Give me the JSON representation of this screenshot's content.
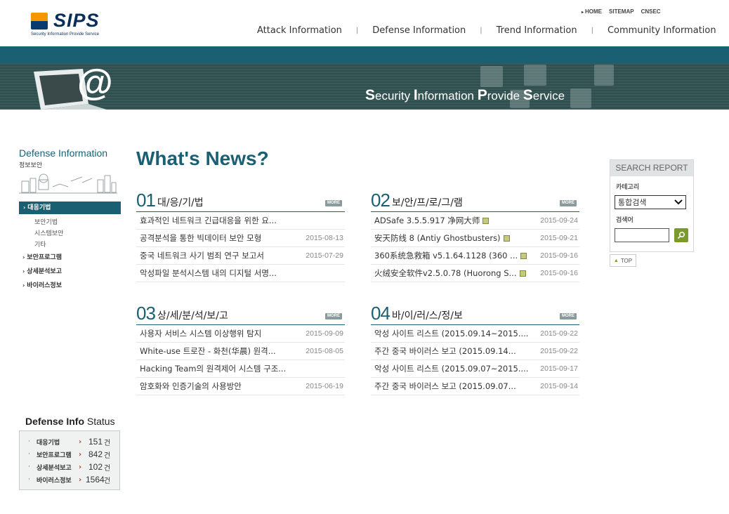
{
  "header": {
    "logo_text": "SIPS",
    "logo_sub": "Security Information Provide Service",
    "util_nav": [
      "HOME",
      "SITEMAP",
      "CNSEC"
    ],
    "gnb": [
      "Attack Information",
      "Defense Information",
      "Trend Information",
      "Community Information"
    ]
  },
  "banner": {
    "tagline": [
      "S",
      "ecurity ",
      "I",
      "nformation ",
      "P",
      "rovide ",
      "S",
      "ervice"
    ]
  },
  "sidebar": {
    "title": "Defense Information",
    "subtitle": "정보보안",
    "active": "대응기법",
    "sub_items": [
      "보안기법",
      "시스템보안",
      "기타"
    ],
    "items": [
      "보안프로그램",
      "상세분석보고",
      "바이러스정보"
    ]
  },
  "status": {
    "title_bold": "Defense Info",
    "title_rest": "Status",
    "rows": [
      {
        "label": "대응기법",
        "count": "151",
        "unit": "건"
      },
      {
        "label": "보안프로그램",
        "count": "842",
        "unit": "건"
      },
      {
        "label": "상세분석보고",
        "count": "102",
        "unit": "건"
      },
      {
        "label": "바이러스정보",
        "count": "1564",
        "unit": "건"
      }
    ]
  },
  "main": {
    "title": "What's News?",
    "more_label": "MORE",
    "boards": [
      {
        "num": "01",
        "name": "대/응/기/법",
        "items": [
          {
            "title": "효과적인 네트워크 긴급대응을 위한 요...",
            "date": "",
            "file": false
          },
          {
            "title": "공격분석을 통한 빅데이터 보안 모형",
            "date": "2015-08-13",
            "file": false
          },
          {
            "title": "중국 네트워크 사기 범죄 연구 보고서",
            "date": "2015-07-29",
            "file": false
          },
          {
            "title": "악성파일 분석시스템 내의 디지털 서명...",
            "date": "",
            "file": false
          }
        ]
      },
      {
        "num": "02",
        "name": "보/안/프/로/그/램",
        "items": [
          {
            "title": "ADSafe 3.5.5.917 净网大师",
            "date": "2015-09-24",
            "file": true
          },
          {
            "title": "安天防线 8 (Antiy Ghostbusters)",
            "date": "2015-09-21",
            "file": true
          },
          {
            "title": "360系统急救箱 v5.1.64.1128 (360 ...",
            "date": "2015-09-16",
            "file": true
          },
          {
            "title": "火绒安全软件v2.5.0.78 (Huorong S...",
            "date": "2015-09-16",
            "file": true
          }
        ]
      },
      {
        "num": "03",
        "name": "상/세/분/석/보/고",
        "items": [
          {
            "title": "사용자 서비스 시스템 이상행위 탐지",
            "date": "2015-09-09",
            "file": false
          },
          {
            "title": "White-use 트로잔 - 화천(华晨) 원격...",
            "date": "2015-08-05",
            "file": false
          },
          {
            "title": "Hacking Team의 원격제어 시스템 구조...",
            "date": "",
            "file": false
          },
          {
            "title": "암호화와 인증기술의 사용방안",
            "date": "2015-06-19",
            "file": false
          }
        ]
      },
      {
        "num": "04",
        "name": "바/이/러/스/정/보",
        "items": [
          {
            "title": "악성 사이트 리스트 (2015.09.14~2015....",
            "date": "2015-09-22",
            "file": false
          },
          {
            "title": "주간 중국 바이러스 보고 (2015.09.14...",
            "date": "2015-09-22",
            "file": false
          },
          {
            "title": "악성 사이트 리스트 (2015.09.07~2015....",
            "date": "2015-09-17",
            "file": false
          },
          {
            "title": "주간 중국 바이러스 보고 (2015.09.07...",
            "date": "2015-09-14",
            "file": false
          }
        ]
      }
    ]
  },
  "search": {
    "header": "SEARCH REPORT",
    "category_label": "카테고리",
    "category_value": "통합검색",
    "keyword_label": "검색어",
    "keyword_value": "",
    "top_label": "TOP"
  },
  "colors": {
    "accent": "#1b5f73",
    "banner": "#2f4f4f",
    "search_button": "#7a9a2a",
    "count_arrow": "#c0392b"
  }
}
